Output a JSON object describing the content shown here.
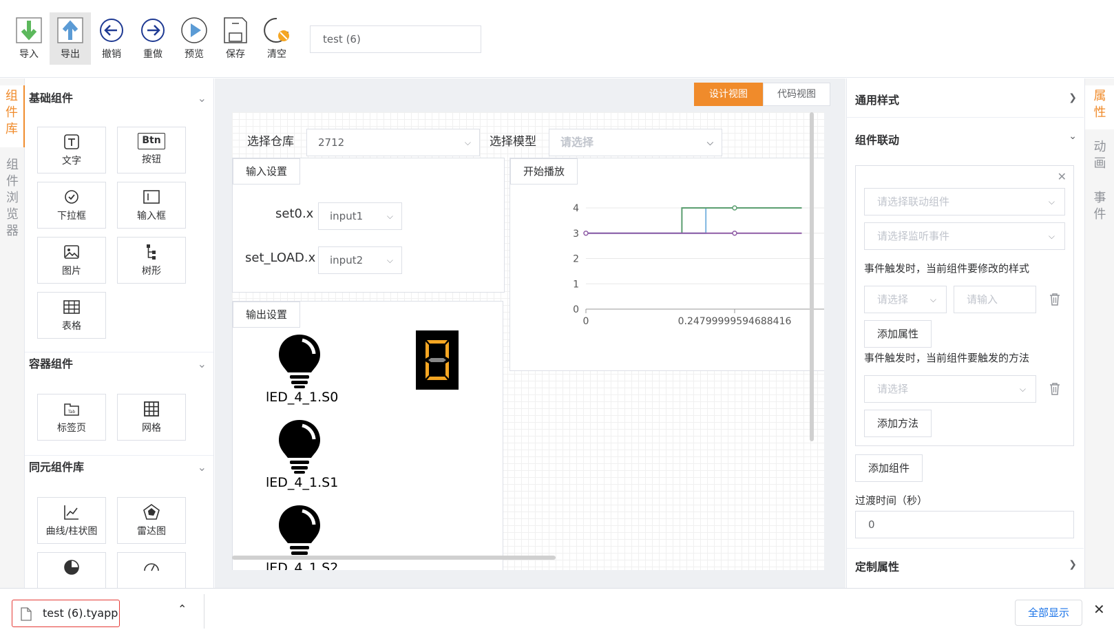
{
  "toolbar": {
    "import": "导入",
    "export": "导出",
    "undo": "撤销",
    "redo": "重做",
    "preview": "预览",
    "save": "保存",
    "clear": "清空",
    "project_name": "test (6)"
  },
  "left_tabs": {
    "library": "组件库",
    "browser": "组件浏览器"
  },
  "library": {
    "basic": {
      "title": "基础组件",
      "items": [
        "文字",
        "按钮",
        "下拉框",
        "输入框",
        "图片",
        "树形",
        "表格"
      ],
      "btn_icon_text": "Btn"
    },
    "container": {
      "title": "容器组件",
      "items": [
        "标签页",
        "网格"
      ]
    },
    "tongyuan": {
      "title": "同元组件库",
      "items": [
        "曲线/柱状图",
        "雷达图"
      ]
    }
  },
  "view_tabs": {
    "design": "设计视图",
    "code": "代码视图"
  },
  "design": {
    "warehouse_label": "选择仓库",
    "warehouse_value": "2712",
    "model_label": "选择模型",
    "model_placeholder": "请选择",
    "input_settings": {
      "tab": "输入设置",
      "rows": [
        {
          "label": "set0.x",
          "value": "input1"
        },
        {
          "label": "set_LOAD.x",
          "value": "input2"
        }
      ]
    },
    "output_settings": {
      "tab": "输出设置",
      "bulbs": [
        "lED_4_1.S0",
        "lED_4_1.S1",
        "lED_4_1.S2"
      ]
    },
    "start_button": "开始播放",
    "chart_data": {
      "type": "line",
      "y_ticks": [
        "0",
        "1",
        "2",
        "3",
        "4"
      ],
      "x_ticks": [
        "0",
        "0.24799999594688416"
      ],
      "ylim": [
        0,
        4
      ],
      "series": [
        {
          "color": "#7eb6e0",
          "points": [
            [
              0,
              3
            ],
            [
              0.2,
              3
            ],
            [
              0.2,
              4
            ],
            [
              0.36,
              4
            ]
          ]
        },
        {
          "color": "#5a9e6f",
          "points": [
            [
              0.16,
              3
            ],
            [
              0.16,
              4
            ],
            [
              0.36,
              4
            ]
          ]
        },
        {
          "color": "#8e5ba5",
          "points": [
            [
              0,
              3
            ],
            [
              0.36,
              3
            ]
          ]
        }
      ]
    }
  },
  "props": {
    "general_style": "通用样式",
    "linkage": "组件联动",
    "linkage_comp_placeholder": "请选择联动组件",
    "linkage_event_placeholder": "请选择监听事件",
    "style_hint": "事件触发时，当前组件要修改的样式",
    "select_placeholder": "请选择",
    "input_placeholder": "请输入",
    "add_attr": "添加属性",
    "method_hint": "事件触发时，当前组件要触发的方法",
    "add_method": "添加方法",
    "add_component": "添加组件",
    "transition_label": "过渡时间（秒）",
    "transition_value": "0",
    "custom_attr": "定制属性"
  },
  "right_tabs": {
    "attr": "属性",
    "anim": "动画",
    "event": "事件"
  },
  "download": {
    "filename": "test (6).tyapp",
    "show_all": "全部显示"
  },
  "colors": {
    "accent": "#f08b2b",
    "lamp_bg": "#000000",
    "lamp_seg": "#f5a623"
  }
}
